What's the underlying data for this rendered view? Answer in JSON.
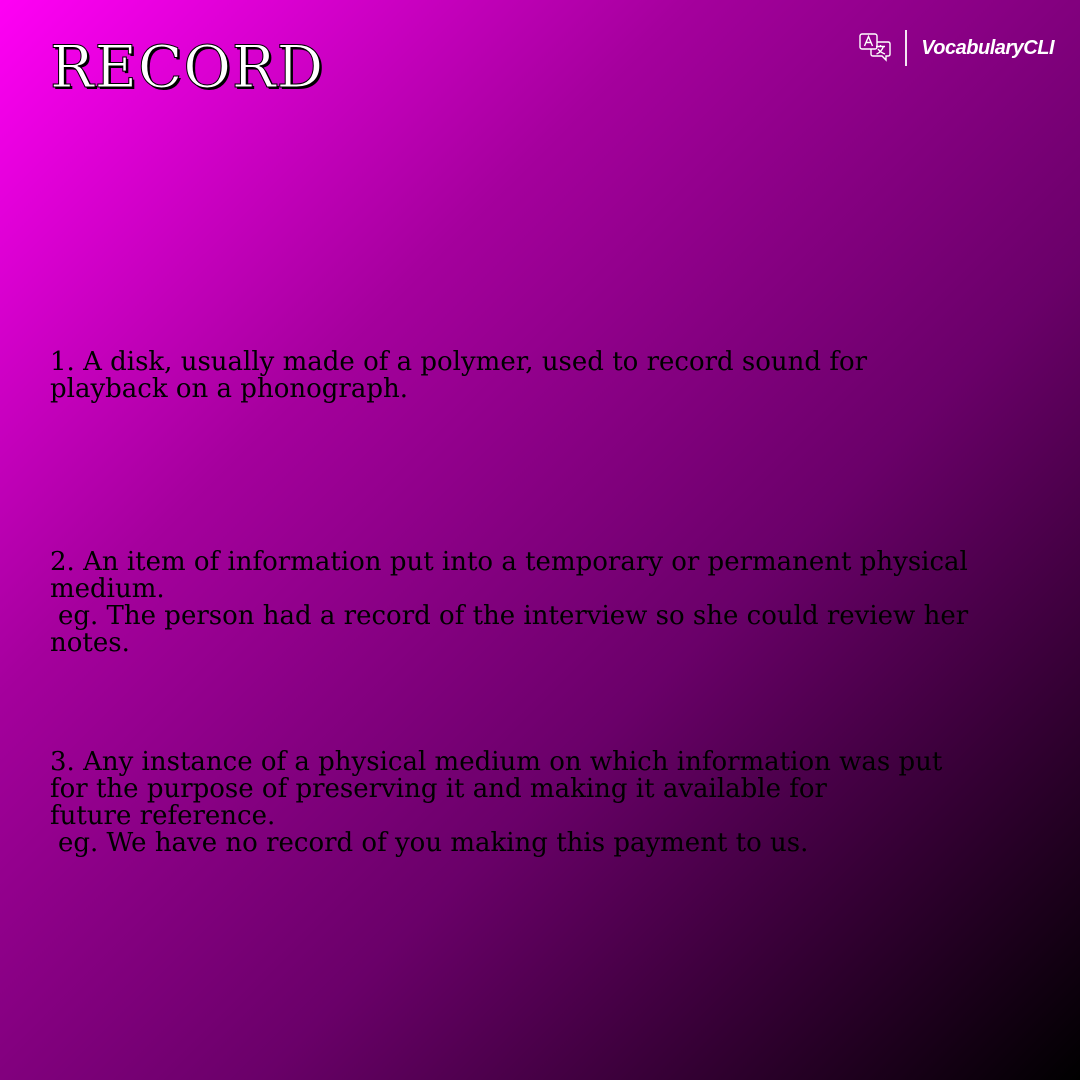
{
  "word": "RECORD",
  "brand": {
    "name": "VocabularyCLI",
    "icon": "translate-icon"
  },
  "definitions": [
    {
      "lines": [
        "1. A disk, usually made of a polymer, used to record sound for",
        "playback on a phonograph."
      ]
    },
    {
      "lines": [
        "2. An item of information put into a temporary or permanent physical",
        "medium."
      ],
      "example": "eg. The person had a record of the interview so she could review her",
      "example_cont": "notes."
    },
    {
      "lines": [
        "3. Any instance of a physical medium on which information was put",
        "for the purpose of preserving it and making it available for",
        "future reference."
      ],
      "example": "eg. We have no record of you making this payment to us."
    }
  ]
}
